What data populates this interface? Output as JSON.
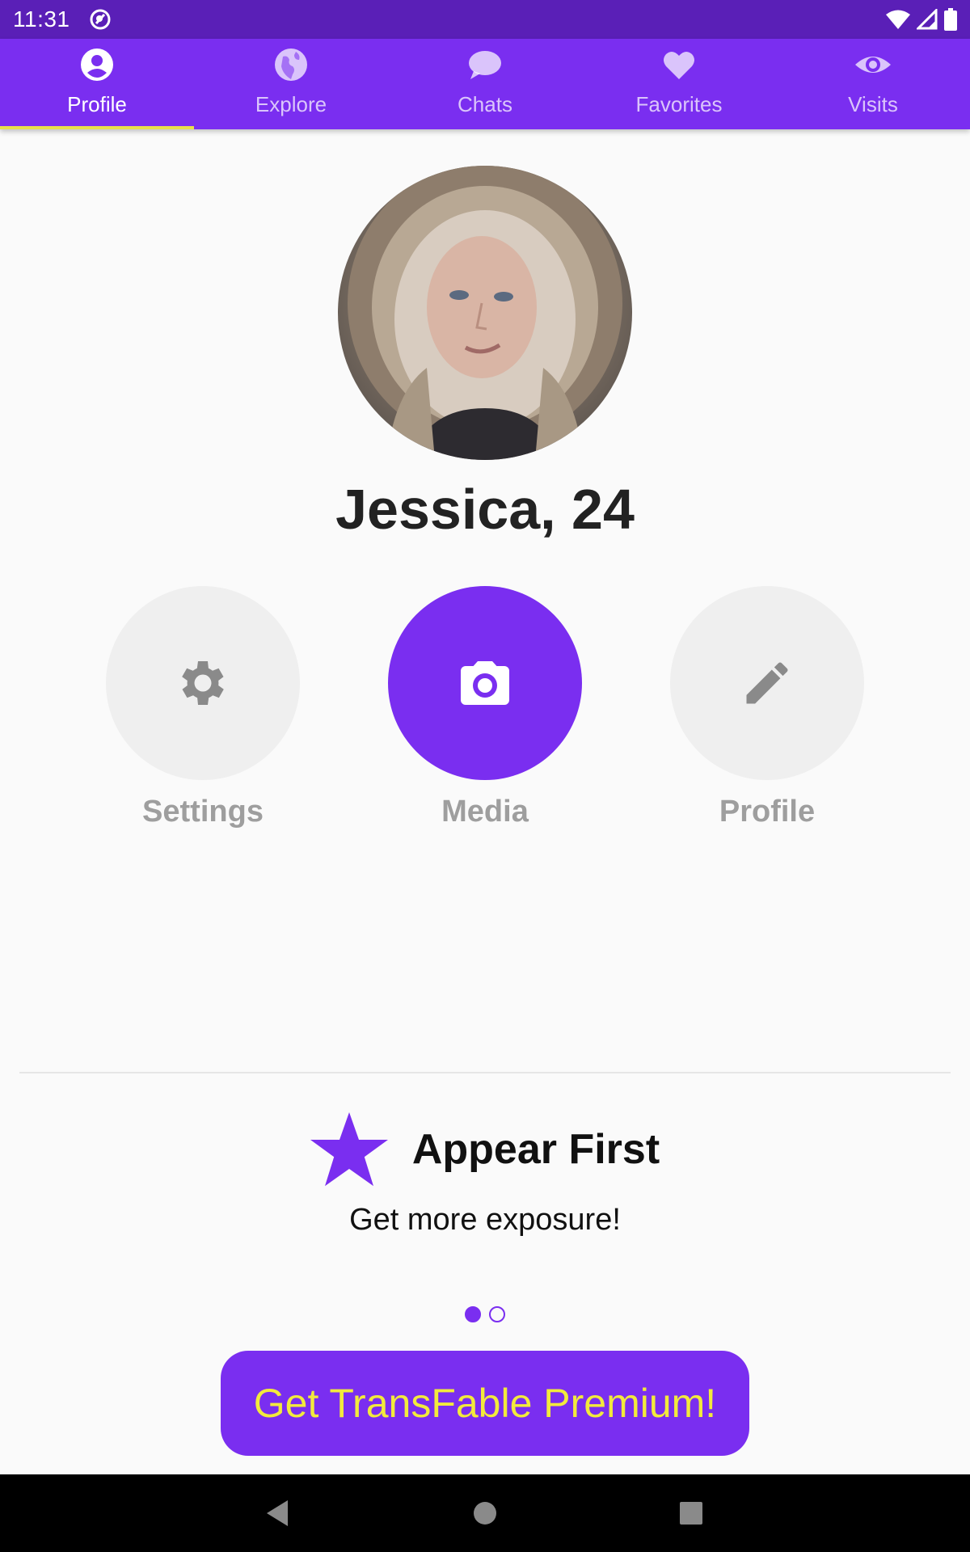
{
  "status_bar": {
    "time": "11:31",
    "icons": [
      "app-notification-icon",
      "wifi-icon",
      "signal-icon",
      "battery-icon"
    ]
  },
  "tabs": [
    {
      "label": "Profile",
      "icon": "account-circle-icon",
      "active": true
    },
    {
      "label": "Explore",
      "icon": "globe-icon",
      "active": false
    },
    {
      "label": "Chats",
      "icon": "chat-bubble-icon",
      "active": false
    },
    {
      "label": "Favorites",
      "icon": "heart-icon",
      "active": false
    },
    {
      "label": "Visits",
      "icon": "eye-icon",
      "active": false
    }
  ],
  "profile": {
    "name": "Jessica, 24"
  },
  "actions": [
    {
      "label": "Settings",
      "icon": "gear-icon",
      "primary": false
    },
    {
      "label": "Media",
      "icon": "camera-icon",
      "primary": true
    },
    {
      "label": "Profile",
      "icon": "pencil-icon",
      "primary": false
    }
  ],
  "promo": {
    "title": "Appear First",
    "subtitle": "Get more exposure!",
    "icon": "star-icon",
    "page_count": 2,
    "active_page": 1
  },
  "premium_button": {
    "label": "Get TransFable Premium!"
  },
  "colors": {
    "status_bar": "#5a1fb7",
    "accent": "#7a2ef0",
    "tab_indicator": "#e7e04a",
    "premium_text": "#f2ea3c",
    "action_bg": "#efefef",
    "action_label": "#9e9e9e"
  },
  "nav_bar": {
    "buttons": [
      "back-icon",
      "home-icon",
      "recents-icon"
    ]
  }
}
